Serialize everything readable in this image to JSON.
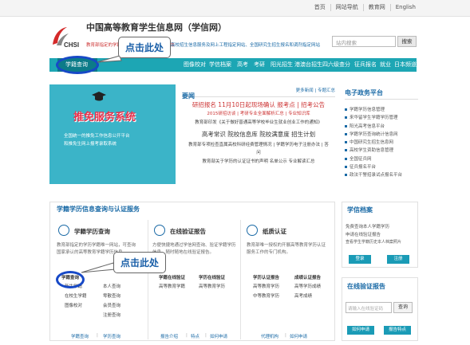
{
  "top_links": [
    "首页",
    "网站导航",
    "教育网",
    "English"
  ],
  "header": {
    "logo_text": "CHSI",
    "title": "中国高等教育学生信息网（学信网）",
    "sub_red": "教育部指定的学籍查询、学历查询、学位查询",
    "sub_blue": "高校招生信息服务及网上工程指定网站、全国研究生招生报名和调剂指定网站",
    "search_placeholder": "站内搜索",
    "search_button": "搜索"
  },
  "nav": {
    "active": "学籍查询",
    "items": [
      "图像校对",
      "学信档案",
      "高考",
      "考研",
      "阳光招生",
      "港澳台招生",
      "四六级查分",
      "征兵报名",
      "就业",
      "日本频道"
    ]
  },
  "callouts": {
    "top": "点击此处",
    "bottom": "点击此处"
  },
  "banner": {
    "title": "推免服务系统",
    "line1": "全国统一的推免工作信息公开平台",
    "line2": "和推免生网上报考录取系统"
  },
  "news": {
    "heading": "要闻",
    "more1": "更多新闻",
    "more2": "专题汇总",
    "line1": "研招报名 11月10日起现场确认 报考点 | 招考公告",
    "line2": "2015研招访谈 | 考研专业全面解析汇总 | 专业知识库",
    "line3": "教育部印发《关于做好普通高等学校毕业生就业创业工作的通知》",
    "line4": "高考常识 院校信息库 院校满意度 招生计划",
    "line5": "教育部专项检查直属高校科研经费管理情况 | 学籍学历电子注册办法 | 答",
    "line6": "问",
    "line7": "教育部关于学历的认证证书的声明 名单公示 专业解读汇总"
  },
  "gov": {
    "heading": "电子政务平台",
    "items": [
      "学籍学历信息管理",
      "来华留学生学籍学历管理",
      "阳光高考信息平台",
      "学籍学历查询统计信息网",
      "中国研究生招生信息网",
      "高校学生资助信息管理",
      "全国征兵网",
      "征兵报名平台",
      "政法干警招录试点报名平台"
    ]
  },
  "section": {
    "title": "学籍学历信息查询与认证服务",
    "c1": {
      "title": "学籍学历查询",
      "desc1": "教育部指定的学历学籍唯一网站，可查询",
      "desc2": "国家承认的高等教育学籍学历信息",
      "col1_head": "学籍查询",
      "col1": [
        "新生学籍",
        "在校生学籍",
        "图像校对"
      ],
      "col2": [
        "本人查询",
        "零散查询",
        "会员查询",
        "注册查询"
      ],
      "footer": [
        "学籍查询",
        "学历查询"
      ]
    },
    "c2": {
      "title": "在线验证报告",
      "desc1": "方便快捷地通过学信网查询、验证学籍学历",
      "desc2": "信息，随时随地在线验证报告。",
      "col1_head": "学籍在线验证",
      "col1": [
        "高等教育学籍"
      ],
      "col2_head": "学历在线验证",
      "col2": [
        "高等教育学历"
      ],
      "footer": [
        "报告介绍",
        "特点",
        "如何申请"
      ]
    },
    "c3": {
      "title": "纸质认证",
      "desc1": "教育部唯一授权的开展高等教育学历认证",
      "desc2": "服务工作的专门机构。",
      "col1_head": "学历认证报告",
      "col1": [
        "高等教育学历",
        "中等教育学历"
      ],
      "col2_head": "成绩认证报告",
      "col2": [
        "高等学历成绩",
        "高考成绩"
      ],
      "footer": [
        "代理机构",
        "如何申请"
      ]
    }
  },
  "archive": {
    "heading": "学信档案",
    "lines": [
      "免费查询本人学籍学历",
      "申请在线验证报告",
      "查看学生学籍历史本人档案照片"
    ],
    "login": "登录",
    "register": "注册"
  },
  "verify": {
    "heading": "在线验证报告",
    "placeholder": "请输入在线验证码",
    "button": "查询",
    "apply": "如何申请",
    "features": "报告特点"
  }
}
